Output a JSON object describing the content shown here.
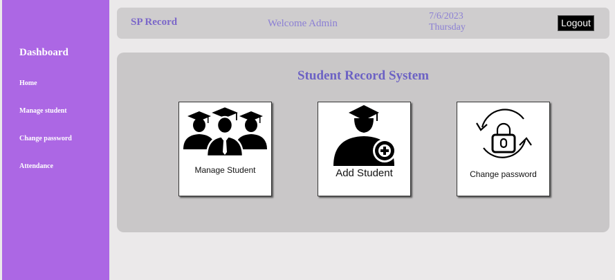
{
  "sidebar": {
    "heading": "Dashboard",
    "items": [
      {
        "label": "Home"
      },
      {
        "label": "Manage student"
      },
      {
        "label": "Change password"
      },
      {
        "label": "Attendance"
      }
    ]
  },
  "header": {
    "brand": "SP Record",
    "welcome": "Welcome Admin",
    "date": "7/6/2023",
    "day": "Thursday",
    "logout_label": "Logout"
  },
  "main": {
    "title": "Student Record System",
    "cards": [
      {
        "label": "Manage Student",
        "icon": "graduates-group-icon"
      },
      {
        "label": "Add Student",
        "icon": "add-student-icon"
      },
      {
        "label": "Change password",
        "icon": "lock-refresh-icon"
      }
    ]
  },
  "colors": {
    "sidebar": "#ac67e4",
    "accent_text": "#7b67c9",
    "panel": "#c9c7c8",
    "topbar": "#cfcdce"
  }
}
